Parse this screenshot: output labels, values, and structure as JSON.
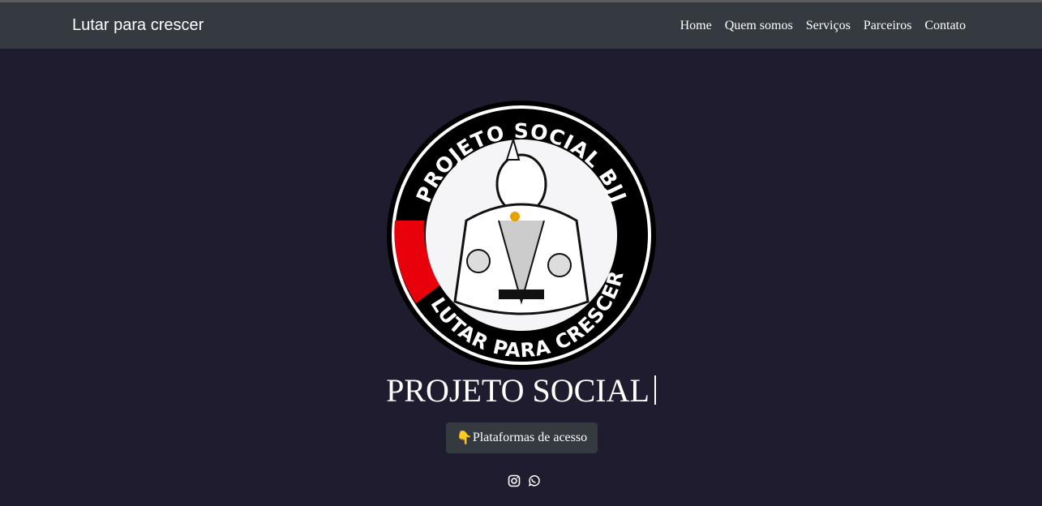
{
  "navbar": {
    "brand": "Lutar para crescer",
    "links": [
      "Home",
      "Quem somos",
      "Serviços",
      "Parceiros",
      "Contato"
    ]
  },
  "logo": {
    "top_text": "PROJETO SOCIAL BJJ",
    "bottom_text": "LUTAR PARA CRESCER",
    "accent": "#e8000b"
  },
  "hero": {
    "title": "PROJETO SOCIAL",
    "button_icon": "👇",
    "button_label": "Plataformas de acesso"
  },
  "social": [
    "instagram-icon",
    "whatsapp-icon"
  ],
  "colors": {
    "background": "#1f1c30",
    "navbar": "#343a40"
  }
}
